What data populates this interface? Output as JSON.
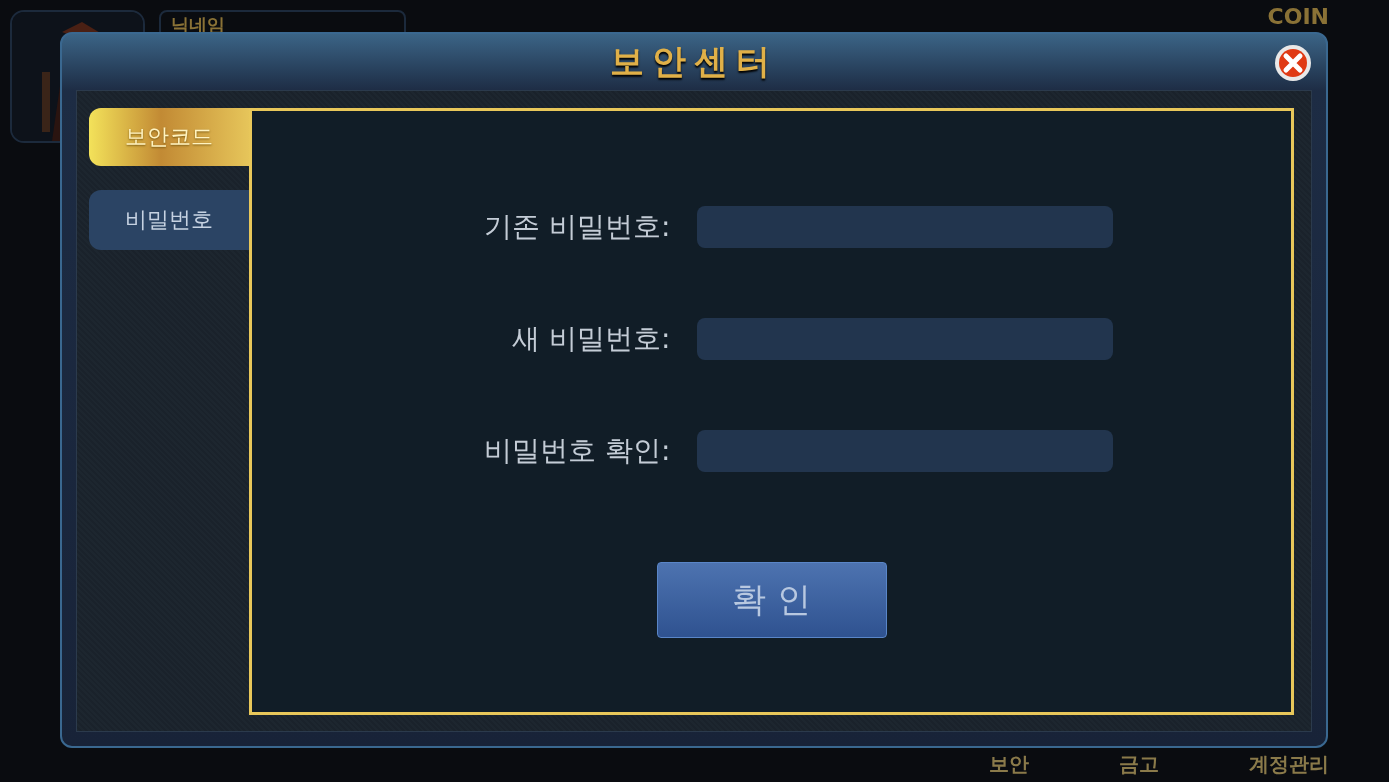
{
  "background": {
    "nickname_label": "닉네임",
    "logo": "COIN",
    "nav": [
      "보안",
      "금고",
      "계정관리"
    ]
  },
  "dialog": {
    "title": "보안센터",
    "tabs": [
      {
        "label": "보안코드",
        "selected": true
      },
      {
        "label": "비밀번호",
        "selected": false
      }
    ],
    "fields": [
      {
        "label": "기존 비밀번호:"
      },
      {
        "label": "새 비밀번호:"
      },
      {
        "label": "비밀번호 확인:"
      }
    ],
    "submit": "확 인"
  }
}
